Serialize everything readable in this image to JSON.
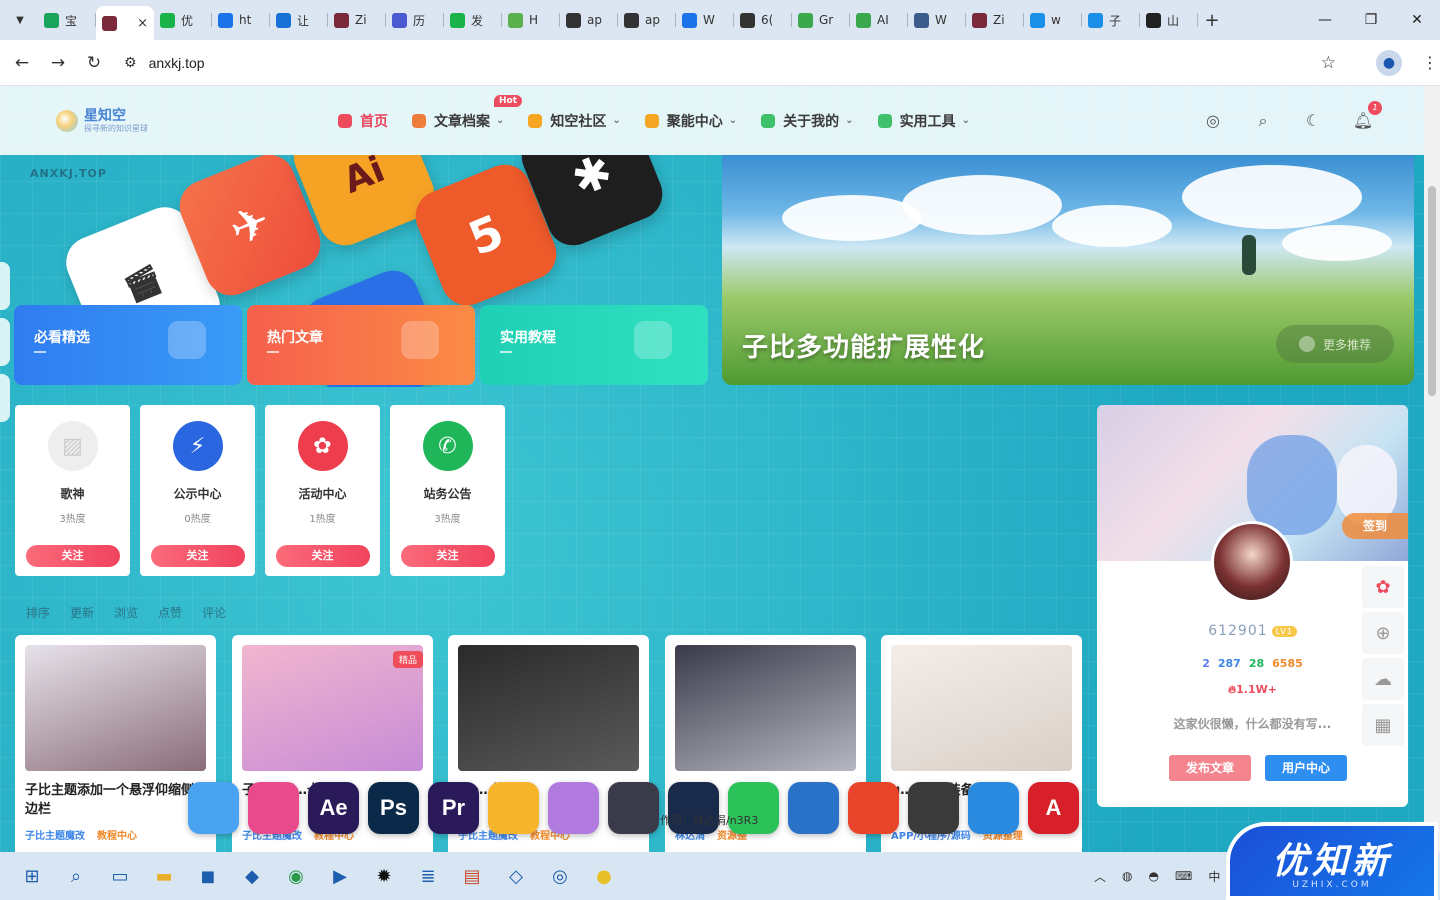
{
  "browser": {
    "tabs": [
      {
        "label": "宝",
        "color": "#1aa35a"
      },
      {
        "label": "",
        "color": "#7a2a3a",
        "active": true
      },
      {
        "label": "优",
        "color": "#19b34a"
      },
      {
        "label": "ht",
        "color": "#1a73e8"
      },
      {
        "label": "让",
        "color": "#1772d8"
      },
      {
        "label": "Zi",
        "color": "#7a2a3a"
      },
      {
        "label": "历",
        "color": "#4a5ad0"
      },
      {
        "label": "发",
        "color": "#19b34a"
      },
      {
        "label": "H",
        "color": "#5bb04e"
      },
      {
        "label": "ap",
        "color": "#333333"
      },
      {
        "label": "ap",
        "color": "#333333"
      },
      {
        "label": "W",
        "color": "#1a73e8"
      },
      {
        "label": "6(",
        "color": "#333333"
      },
      {
        "label": "Gr",
        "color": "#3aa84d"
      },
      {
        "label": "AI",
        "color": "#3aa84d"
      },
      {
        "label": "W",
        "color": "#3a5b8c"
      },
      {
        "label": "Zi",
        "color": "#7a2a3a"
      },
      {
        "label": "w",
        "color": "#1a8fe8"
      },
      {
        "label": "子",
        "color": "#1a8fe8"
      },
      {
        "label": "山",
        "color": "#222222"
      }
    ],
    "tab_close": "×",
    "new_tab": "+",
    "url": "anxkj.top"
  },
  "site": {
    "logo_name": "星知空",
    "logo_sub": "探寻新的知识星球",
    "nav": [
      {
        "label": "首页",
        "color": "#ef4b5e",
        "current": true,
        "dropdown": false
      },
      {
        "label": "文章档案",
        "color": "#f07c3c",
        "current": false,
        "dropdown": true,
        "badge": "Hot"
      },
      {
        "label": "知空社区",
        "color": "#f6a623",
        "current": false,
        "dropdown": true
      },
      {
        "label": "聚能中心",
        "color": "#f6a623",
        "current": false,
        "dropdown": true
      },
      {
        "label": "关于我的",
        "color": "#3ec16a",
        "current": false,
        "dropdown": true
      },
      {
        "label": "实用工具",
        "color": "#3ec16a",
        "current": false,
        "dropdown": true
      }
    ],
    "notify_count": "1"
  },
  "hero": {
    "watermark": "ANXKJ.TOP",
    "features": [
      {
        "label": "必看精选",
        "color_a": "#2f7cf0",
        "color_b": "#3a9bf6"
      },
      {
        "label": "热门文章",
        "color_a": "#f6604d",
        "color_b": "#fb8b45"
      },
      {
        "label": "实用教程",
        "color_a": "#1fd0b4",
        "color_b": "#2fe0c0"
      }
    ],
    "banner_title": "子比多功能扩展性化",
    "more_label": "更多推荐"
  },
  "categories": [
    {
      "name": "歌神",
      "heat": "3热度",
      "follow": "关注",
      "color": "#eeeeee"
    },
    {
      "name": "公示中心",
      "heat": "0热度",
      "follow": "关注",
      "color": "#2a66e0"
    },
    {
      "name": "活动中心",
      "heat": "1热度",
      "follow": "关注",
      "color": "#ee3d4d"
    },
    {
      "name": "站务公告",
      "heat": "3热度",
      "follow": "关注",
      "color": "#1fb65a"
    }
  ],
  "sort_tabs": [
    "排序",
    "更新",
    "浏览",
    "点赞",
    "评论"
  ],
  "posts": [
    {
      "title": "子比主题添加一个悬浮仰缩侧边栏",
      "tag1": "子比主题魔改",
      "tag2": "教程中心",
      "bg_a": "#e7e2ea",
      "bg_b": "#8a6d7a",
      "chip": ""
    },
    {
      "title": "子比加固…卡片",
      "tag1": "子比主题魔改",
      "tag2": "教程中心",
      "bg_a": "#f2b6cf",
      "bg_b": "#c68bd6",
      "chip": "精品"
    },
    {
      "title": "wo…板",
      "tag1": "子比主题魔改",
      "tag2": "教程中心",
      "bg_a": "#2a2a2a",
      "bg_b": "#5a5a5a",
      "chip": ""
    },
    {
      "title": "无…二",
      "tag1": "林达涓",
      "tag2": "资源整",
      "bg_a": "#3a3a4a",
      "bg_b": "#b7b7c2",
      "chip": ""
    },
    {
      "title": "u…s1… 装备…扩",
      "tag1": "APP/小程序/源码",
      "tag2": "资源整理",
      "bg_a": "#f3eeea",
      "bg_b": "#d9cfc7",
      "chip": ""
    }
  ],
  "profile": {
    "sign_in": "签到",
    "username": "612901",
    "level": "LV1",
    "stats": [
      {
        "label": "2",
        "color": "#5b7ff0"
      },
      {
        "label": "287",
        "color": "#3f87e8"
      },
      {
        "label": "28",
        "color": "#1fb65a"
      },
      {
        "label": "6585",
        "color": "#f08a2d"
      }
    ],
    "heat": "1.1W+",
    "bio": "这家伙很懒，什么都没有写...",
    "publish": "发布文章",
    "user_center": "用户中心"
  },
  "dock": {
    "icons": [
      {
        "label": "",
        "color": "#4aa3f0"
      },
      {
        "label": "",
        "color": "#e84a8c"
      },
      {
        "label": "Ae",
        "color": "#2a1a5a"
      },
      {
        "label": "Ps",
        "color": "#0b2a4a"
      },
      {
        "label": "Pr",
        "color": "#2a1a5a"
      },
      {
        "label": "",
        "color": "#f6b52a"
      },
      {
        "label": "",
        "color": "#b07adf"
      },
      {
        "label": "",
        "color": "#3a3a4a"
      },
      {
        "label": "",
        "color": "#1a2a4a"
      },
      {
        "label": "",
        "color": "#2bc25a"
      },
      {
        "label": "",
        "color": "#2a72c8"
      },
      {
        "label": "",
        "color": "#e8442a"
      },
      {
        "label": "",
        "color": "#3a3a3a"
      },
      {
        "label": "",
        "color": "#2a8ae0"
      },
      {
        "label": "A",
        "color": "#d8202a"
      }
    ],
    "lyric": "作词：林达涓/n3R3"
  },
  "watermark_brand": {
    "big": "优知新",
    "small": "UZHIX.COM"
  },
  "taskbar": {
    "ime": "中"
  }
}
